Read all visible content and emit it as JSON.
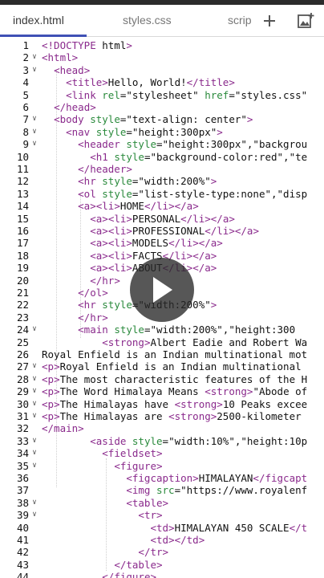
{
  "tabs": [
    {
      "label": "index.html",
      "active": true
    },
    {
      "label": "styles.css",
      "active": false
    },
    {
      "label": "scrip",
      "active": false
    }
  ],
  "toolbar": {
    "add_icon": "plus-icon",
    "image_icon": "add-image-icon"
  },
  "colors": {
    "accent": "#3f51b5",
    "tag": "#8a2a8c",
    "attr": "#2a8a3c",
    "play_bg": "#282828"
  },
  "video": {
    "icon": "play-icon"
  },
  "lines": [
    {
      "n": "1",
      "fold": false,
      "text": "<!DOCTYPE html>"
    },
    {
      "n": "2",
      "fold": true,
      "text": "<html>"
    },
    {
      "n": "3",
      "fold": true,
      "text": "  <head>"
    },
    {
      "n": "4",
      "fold": false,
      "text": "    <title>Hello, World!</title>"
    },
    {
      "n": "5",
      "fold": false,
      "text": "    <link rel=\"stylesheet\" href=\"styles.css\""
    },
    {
      "n": "6",
      "fold": false,
      "text": "  </head>"
    },
    {
      "n": "7",
      "fold": true,
      "text": "  <body style=\"text-align: center\">"
    },
    {
      "n": "8",
      "fold": true,
      "text": "    <nav style=\"height:300px\">"
    },
    {
      "n": "9",
      "fold": true,
      "text": "      <header style=\"height:300px\",\"backgrou"
    },
    {
      "n": "10",
      "fold": false,
      "text": "        <h1 style=\"background-color:red\",\"te"
    },
    {
      "n": "11",
      "fold": false,
      "text": "      </header>"
    },
    {
      "n": "12",
      "fold": false,
      "text": "      <hr style=\"width:200%\">"
    },
    {
      "n": "13",
      "fold": false,
      "text": "      <ol style=\"list-style-type:none\",\"disp"
    },
    {
      "n": "14",
      "fold": false,
      "text": "      <a><li>HOME</li></a>"
    },
    {
      "n": "15",
      "fold": false,
      "text": "        <a><li>PERSONAL</li></a>"
    },
    {
      "n": "16",
      "fold": false,
      "text": "        <a><li>PROFESSIONAL</li></a>"
    },
    {
      "n": "17",
      "fold": false,
      "text": "        <a><li>MODELS</li></a>"
    },
    {
      "n": "18",
      "fold": false,
      "text": "        <a><li>FACTS</li></a>"
    },
    {
      "n": "19",
      "fold": false,
      "text": "        <a><li>ABOUT</li></a>"
    },
    {
      "n": "20",
      "fold": false,
      "text": "        </hr>"
    },
    {
      "n": "21",
      "fold": false,
      "text": "      </ol>"
    },
    {
      "n": "22",
      "fold": false,
      "text": "      <hr style=\"width:200%\">"
    },
    {
      "n": "23",
      "fold": false,
      "text": "      </hr>"
    },
    {
      "n": "24",
      "fold": true,
      "text": "      <main style=\"width:200%\",\"height:300"
    },
    {
      "n": "25",
      "fold": false,
      "text": "          <strong>Albert Eadie and Robert Wa"
    },
    {
      "n": "26",
      "fold": false,
      "text": "Royal Enfield is an Indian multinational mot"
    },
    {
      "n": "27",
      "fold": true,
      "text": "<p>Royal Enfield is an Indian multinational"
    },
    {
      "n": "28",
      "fold": true,
      "text": "<p>The most characteristic features of the H"
    },
    {
      "n": "29",
      "fold": true,
      "text": "<p>The Word Himalaya Means <strong>\"Abode of"
    },
    {
      "n": "30",
      "fold": true,
      "text": "<p>The Himalayas have <strong>10 Peaks excee"
    },
    {
      "n": "31",
      "fold": true,
      "text": "<p>The Himalayas are <strong>2500-kilometer"
    },
    {
      "n": "32",
      "fold": false,
      "text": "</main>"
    },
    {
      "n": "33",
      "fold": true,
      "text": "        <aside style=\"width:10%\",\"height:10p"
    },
    {
      "n": "34",
      "fold": true,
      "text": "          <fieldset>"
    },
    {
      "n": "35",
      "fold": true,
      "text": "            <figure>"
    },
    {
      "n": "36",
      "fold": false,
      "text": "              <figcaption>HIMALAYAN</figcapt"
    },
    {
      "n": "37",
      "fold": false,
      "text": "              <img src=\"https://www.royalenf"
    },
    {
      "n": "38",
      "fold": true,
      "text": "              <table>"
    },
    {
      "n": "39",
      "fold": true,
      "text": "                <tr>"
    },
    {
      "n": "40",
      "fold": false,
      "text": "                  <td>HIMALAYAN 450 SCALE</t"
    },
    {
      "n": "41",
      "fold": false,
      "text": "                  <td></td>"
    },
    {
      "n": "42",
      "fold": false,
      "text": "                </tr>"
    },
    {
      "n": "43",
      "fold": false,
      "text": "            </table>"
    },
    {
      "n": "44",
      "fold": false,
      "text": "          </figure>"
    }
  ]
}
